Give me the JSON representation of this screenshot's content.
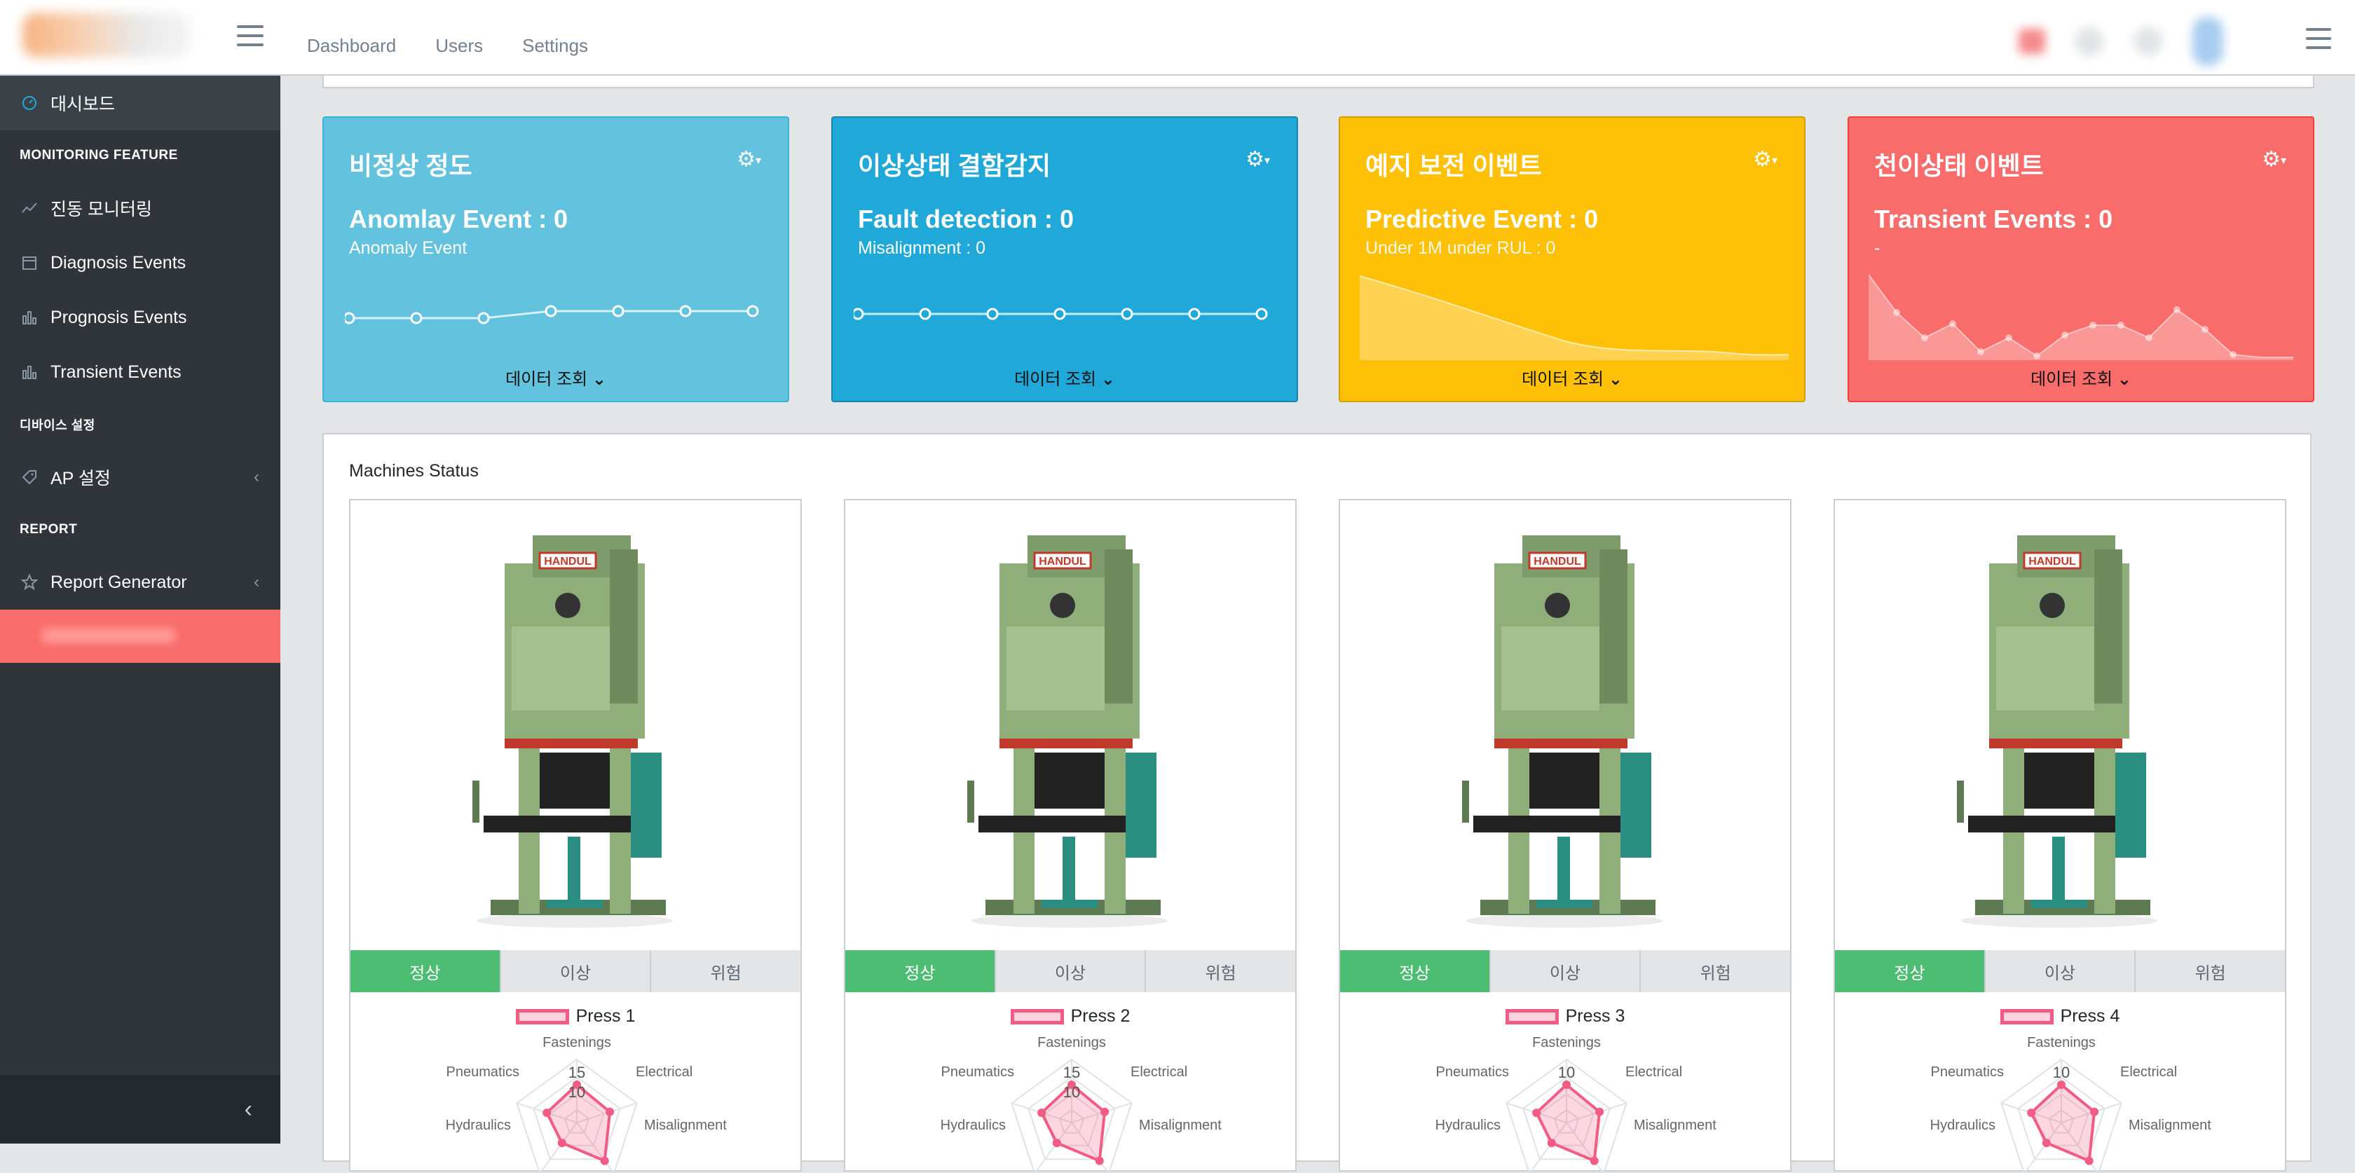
{
  "header": {
    "nav": [
      "Dashboard",
      "Users",
      "Settings"
    ]
  },
  "sidebar": {
    "dashboard": "대시보드",
    "section_monitoring": "MONITORING FEATURE",
    "vibration": "진동 모니터링",
    "diagnosis": "Diagnosis Events",
    "prognosis": "Prognosis Events",
    "transient": "Transient Events",
    "section_device": "디바이스 설정",
    "ap": "AP 설정",
    "section_report": "REPORT",
    "report_gen": "Report Generator"
  },
  "cards": [
    {
      "title": "비정상 정도",
      "value": "Anomlay Event : 0",
      "sub": "Anomaly Event",
      "more": "데이터 조회",
      "color": "#63c2de"
    },
    {
      "title": "이상상태 결함감지",
      "value": "Fault detection : 0",
      "sub": "Misalignment : 0",
      "more": "데이터 조회",
      "color": "#20a8d8"
    },
    {
      "title": "예지 보전 이벤트",
      "value": "Predictive Event : 0",
      "sub": "Under 1M under RUL : 0",
      "more": "데이터 조회",
      "color": "#ffc107"
    },
    {
      "title": "천이상태 이벤트",
      "value": "Transient Events : 0",
      "sub": "-",
      "more": "데이터 조회",
      "color": "#f86c6b"
    }
  ],
  "panel": {
    "title": "Machines Status",
    "status_labels": [
      "정상",
      "이상",
      "위험"
    ],
    "radar_axes": [
      "Fastenings",
      "Electrical",
      "Misalignment",
      "Hydraulics",
      "Pneumatics"
    ]
  },
  "machines": [
    {
      "name": "Press 1",
      "ticks": [
        "15",
        "10"
      ],
      "status": "정상"
    },
    {
      "name": "Press 2",
      "ticks": [
        "15",
        "10"
      ],
      "status": "정상"
    },
    {
      "name": "Press 3",
      "ticks": [
        "10"
      ],
      "status": "정상"
    },
    {
      "name": "Press 4",
      "ticks": [
        "10"
      ],
      "status": "정상"
    }
  ],
  "colors": {
    "sidebar": "#2f353a",
    "active_status": "#4dbd74",
    "radar": "#f25c84"
  },
  "icons": [
    "speedometer-icon",
    "chart-line-icon",
    "calendar-icon",
    "bar-chart-icon",
    "tag-icon",
    "star-icon",
    "chevron-left-icon",
    "gear-icon",
    "chevron-down-icon",
    "menu-icon"
  ]
}
